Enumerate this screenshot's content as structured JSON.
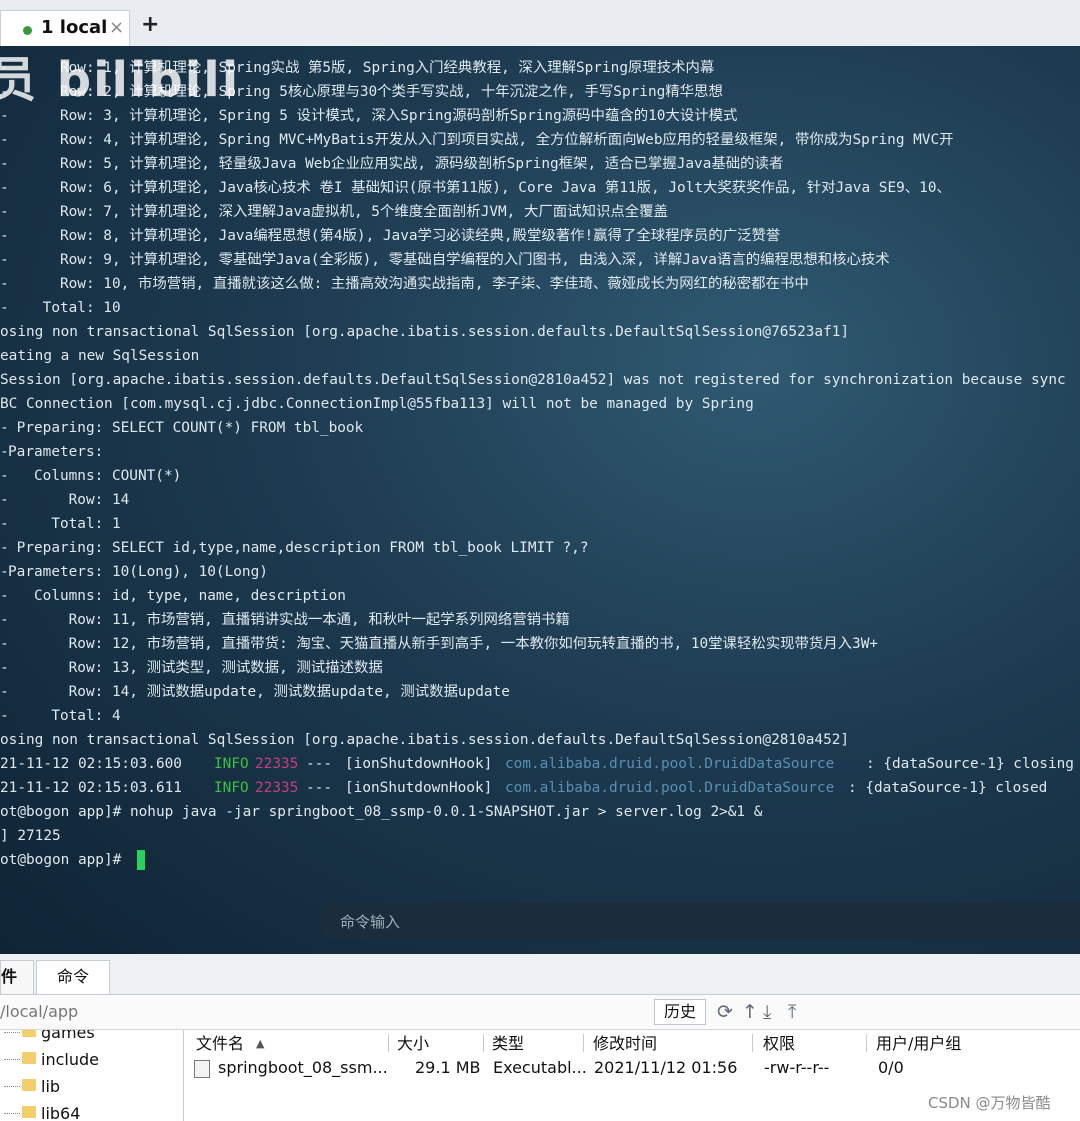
{
  "tab": {
    "label": "1 local",
    "close": "×",
    "add": "+"
  },
  "watermark": "员 bilibili",
  "terminal": {
    "lines": [
      {
        "gutter": "-",
        "text": "      Row: 1, 计算机理论, Spring实战 第5版, Spring入门经典教程, 深入理解Spring原理技术内幕"
      },
      {
        "gutter": "-",
        "text": "      Row: 2, 计算机理论, Spring 5核心原理与30个类手写实战, 十年沉淀之作, 手写Spring精华思想"
      },
      {
        "gutter": "-",
        "text": "      Row: 3, 计算机理论, Spring 5 设计模式, 深入Spring源码剖析Spring源码中蕴含的10大设计模式"
      },
      {
        "gutter": "-",
        "text": "      Row: 4, 计算机理论, Spring MVC+MyBatis开发从入门到项目实战, 全方位解析面向Web应用的轻量级框架, 带你成为Spring MVC开"
      },
      {
        "gutter": "-",
        "text": "      Row: 5, 计算机理论, 轻量级Java Web企业应用实战, 源码级剖析Spring框架, 适合已掌握Java基础的读者"
      },
      {
        "gutter": "-",
        "text": "      Row: 6, 计算机理论, Java核心技术 卷I 基础知识(原书第11版), Core Java 第11版, Jolt大奖获奖作品, 针对Java SE9、10、"
      },
      {
        "gutter": "-",
        "text": "      Row: 7, 计算机理论, 深入理解Java虚拟机, 5个维度全面剖析JVM, 大厂面试知识点全覆盖"
      },
      {
        "gutter": "-",
        "text": "      Row: 8, 计算机理论, Java编程思想(第4版), Java学习必读经典,殿堂级著作!赢得了全球程序员的广泛赞誉"
      },
      {
        "gutter": "-",
        "text": "      Row: 9, 计算机理论, 零基础学Java(全彩版), 零基础自学编程的入门图书, 由浅入深, 详解Java语言的编程思想和核心技术"
      },
      {
        "gutter": "-",
        "text": "      Row: 10, 市场营销, 直播就该这么做: 主播高效沟通实战指南, 李子柒、李佳琦、薇娅成长为网红的秘密都在书中"
      },
      {
        "gutter": "-",
        "text": "    Total: 10"
      },
      {
        "gutter": "",
        "text": "osing non transactional SqlSession [org.apache.ibatis.session.defaults.DefaultSqlSession@76523af1]"
      },
      {
        "gutter": "",
        "text": "eating a new SqlSession"
      },
      {
        "gutter": "",
        "text": "Session [org.apache.ibatis.session.defaults.DefaultSqlSession@2810a452] was not registered for synchronization because sync"
      },
      {
        "gutter": "",
        "text": "BC Connection [com.mysql.cj.jdbc.ConnectionImpl@55fba113] will not be managed by Spring"
      },
      {
        "gutter": "-",
        "text": " Preparing: SELECT COUNT(*) FROM tbl_book"
      },
      {
        "gutter": "-",
        "text": "Parameters:"
      },
      {
        "gutter": "-",
        "text": "   Columns: COUNT(*)"
      },
      {
        "gutter": "-",
        "text": "       Row: 14"
      },
      {
        "gutter": "-",
        "text": "     Total: 1"
      },
      {
        "gutter": "-",
        "text": " Preparing: SELECT id,type,name,description FROM tbl_book LIMIT ?,?"
      },
      {
        "gutter": "-",
        "text": "Parameters: 10(Long), 10(Long)"
      },
      {
        "gutter": "-",
        "text": "   Columns: id, type, name, description"
      },
      {
        "gutter": "-",
        "text": "       Row: 11, 市场营销, 直播销讲实战一本通, 和秋叶一起学系列网络营销书籍"
      },
      {
        "gutter": "-",
        "text": "       Row: 12, 市场营销, 直播带货: 淘宝、天猫直播从新手到高手, 一本教你如何玩转直播的书, 10堂课轻松实现带货月入3W+"
      },
      {
        "gutter": "-",
        "text": "       Row: 13, 测试类型, 测试数据, 测试描述数据"
      },
      {
        "gutter": "-",
        "text": "       Row: 14, 测试数据update, 测试数据update, 测试数据update"
      },
      {
        "gutter": "-",
        "text": "     Total: 4"
      },
      {
        "gutter": "",
        "text": "osing non transactional SqlSession [org.apache.ibatis.session.defaults.DefaultSqlSession@2810a452]"
      }
    ],
    "log1": {
      "date": "21-11-12 02:15:03.600",
      "level": "INFO",
      "pid": "22335",
      "sep": "---",
      "thread": "[ionShutdownHook]",
      "logger": "com.alibaba.druid.pool.DruidDataSource",
      "msg": ": {dataSource-1} closing"
    },
    "log2": {
      "date": "21-11-12 02:15:03.611",
      "level": "INFO",
      "pid": "22335",
      "sep": "---",
      "thread": "[ionShutdownHook]",
      "logger": "com.alibaba.druid.pool.DruidDataSource",
      "msg": ": {dataSource-1} closed"
    },
    "cmd1": "ot@bogon app]# nohup java -jar springboot_08_ssmp-0.0.1-SNAPSHOT.jar > server.log 2>&1 &",
    "job": "] 27125",
    "prompt": "ot@bogon app]# ",
    "command_input_placeholder": "命令输入"
  },
  "bottom_tabs": [
    "件",
    "命令"
  ],
  "path": "/local/app",
  "history_button": "历史",
  "tree_items": [
    "games",
    "include",
    "lib",
    "lib64"
  ],
  "file_headers": {
    "name": "文件名",
    "sort": "▲",
    "size": "大小",
    "type": "类型",
    "modified": "修改时间",
    "perm": "权限",
    "owner": "用户/用户组"
  },
  "file_row": {
    "name": "springboot_08_ssm...",
    "size": "29.1 MB",
    "type": "Executabl...",
    "modified": "2021/11/12 01:56",
    "perm": "-rw-r--r--",
    "owner": "0/0"
  },
  "csdn_watermark": "CSDN @万物皆酷"
}
